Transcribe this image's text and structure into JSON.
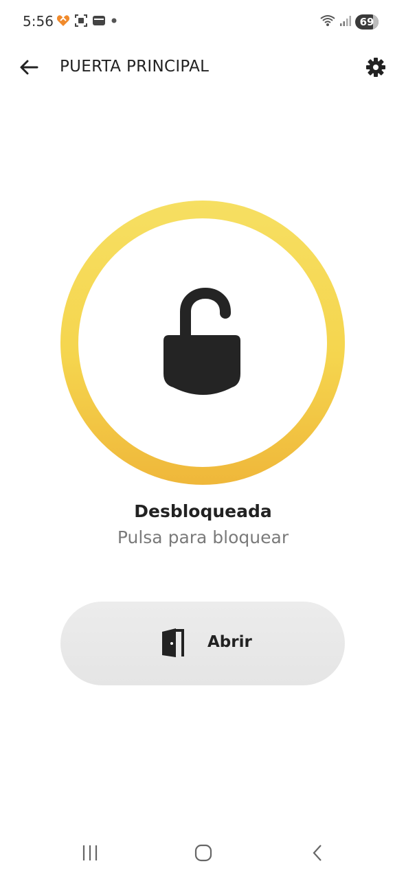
{
  "status_bar": {
    "time": "5:56",
    "battery_level": "69",
    "left_icons": [
      "health-heart-icon",
      "screenshot-icon",
      "wallet-card-icon",
      "notification-dot-icon"
    ],
    "right_icons": [
      "wifi-icon",
      "signal-icon",
      "battery-icon"
    ]
  },
  "header": {
    "title": "PUERTA PRINCIPAL",
    "back_icon": "arrow-left-icon",
    "settings_icon": "gear-icon"
  },
  "lock": {
    "icon": "padlock-unlocked-icon",
    "state": "Desbloqueada",
    "hint": "Pulsa para bloquear",
    "ring_colors": [
      "#f6df62",
      "#efb73a"
    ]
  },
  "open_button": {
    "icon": "door-open-icon",
    "label": "Abrir"
  },
  "nav_bar": {
    "icons": [
      "recents-icon",
      "home-icon",
      "back-chevron-icon"
    ]
  }
}
